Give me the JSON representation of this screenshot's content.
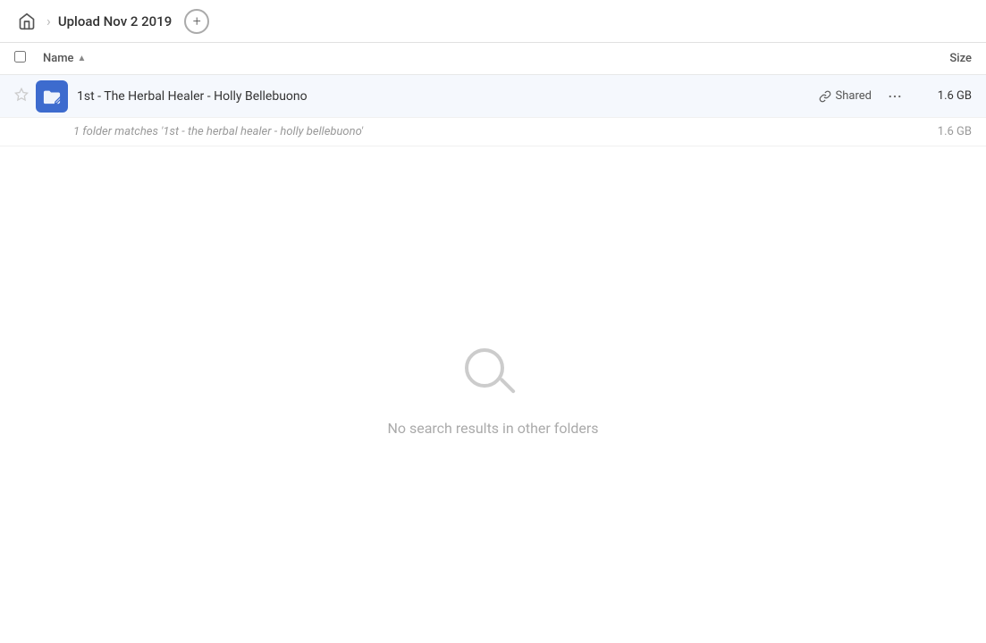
{
  "header": {
    "home_icon": "🏠",
    "breadcrumb": "Upload Nov 2 2019",
    "add_button_label": "+"
  },
  "columns": {
    "name_label": "Name",
    "name_sort": "▲",
    "size_label": "Size"
  },
  "file_row": {
    "name": "1st - The Herbal Healer - Holly Bellebuono",
    "shared_label": "Shared",
    "size": "1.6 GB",
    "more_options": "···"
  },
  "match_info": {
    "text": "1 folder matches '1st - the herbal healer - holly bellebuono'",
    "size": "1.6 GB"
  },
  "empty_state": {
    "text": "No search results in other folders"
  }
}
